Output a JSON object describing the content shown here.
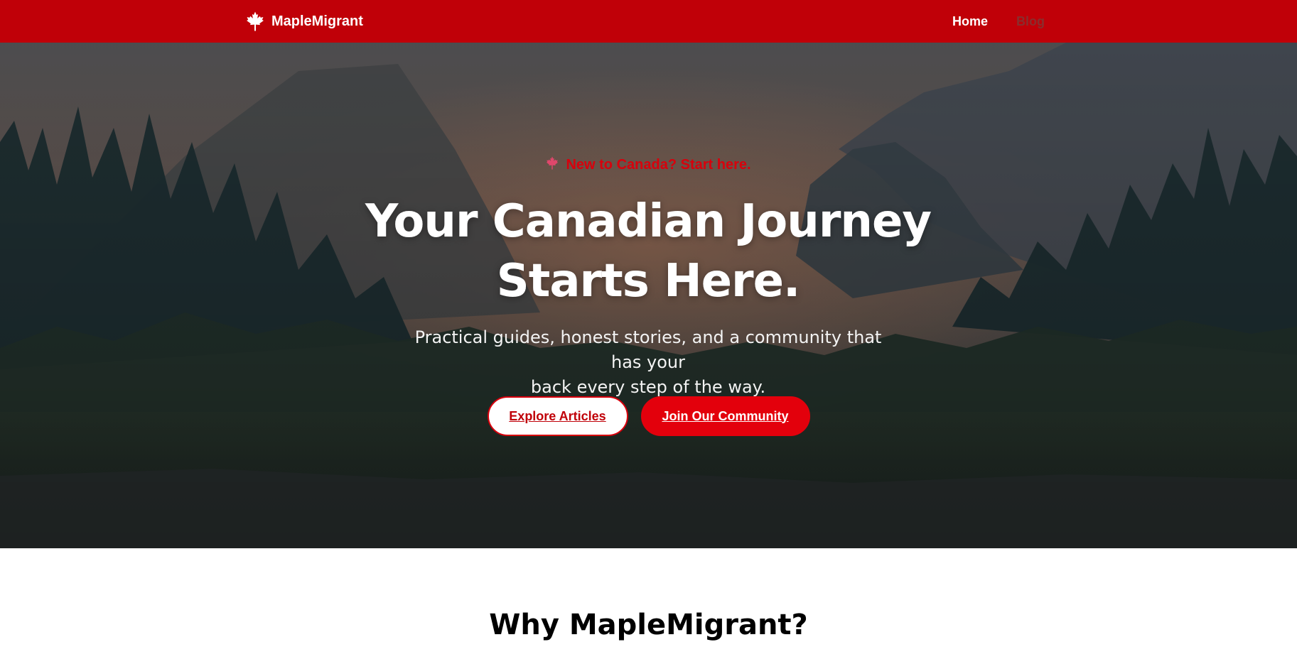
{
  "colors": {
    "brand_red": "#c00008",
    "accent_red": "#e3000c",
    "white": "#ffffff"
  },
  "navbar": {
    "brand_icon": "maple-leaf-icon",
    "brand_name": "MapleMigrant",
    "links": [
      {
        "label": "Home",
        "active": true
      },
      {
        "label": "Blog",
        "active": false
      }
    ]
  },
  "hero": {
    "eyebrow_icon": "maple-leaf-icon",
    "eyebrow_text": "New to Canada? Start here.",
    "title_line1": "Your Canadian Journey",
    "title_line2": "Starts Here.",
    "subtitle_line1": "Practical guides, honest stories, and a community that has your",
    "subtitle_line2": "back every step of the way.",
    "primary_button": "Explore Articles",
    "secondary_button": "Join Our Community"
  },
  "why_section": {
    "title": "Why MapleMigrant?"
  }
}
